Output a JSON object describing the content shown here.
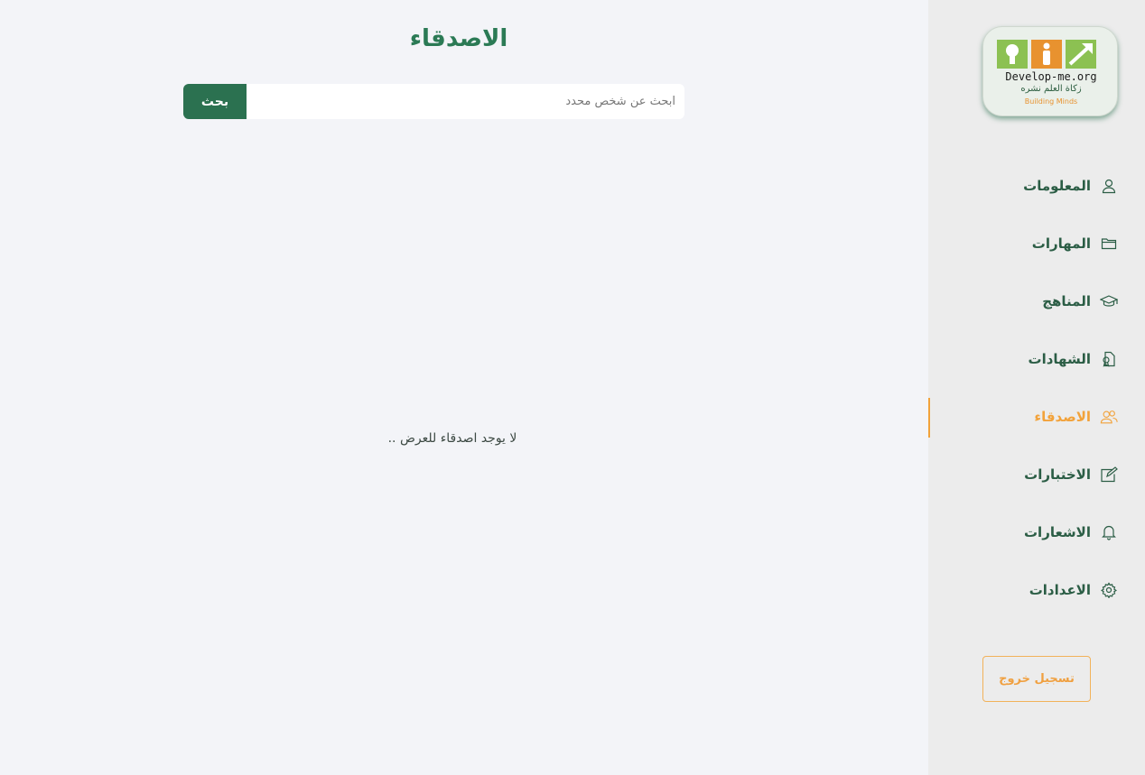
{
  "main": {
    "title": "الاصدقاء",
    "search": {
      "placeholder": "ابحث عن شخص محدد",
      "value": "",
      "button_label": "بحث"
    },
    "empty_message": "لا يوجد اصدقاء للعرض .."
  },
  "sidebar": {
    "logo": {
      "url_text": "Develop-me.org",
      "arabic_text": "زكاة العلم نشره",
      "tagline": "Building Minds"
    },
    "items": [
      {
        "label": "المعلومات",
        "icon": "user-icon"
      },
      {
        "label": "المهارات",
        "icon": "folder-icon"
      },
      {
        "label": "المناهج",
        "icon": "graduation-cap-icon"
      },
      {
        "label": "الشهادات",
        "icon": "certificate-icon"
      },
      {
        "label": "الاصدقاء",
        "icon": "users-icon",
        "active": true
      },
      {
        "label": "الاختبارات",
        "icon": "edit-icon"
      },
      {
        "label": "الاشعارات",
        "icon": "bell-icon"
      },
      {
        "label": "الاعدادات",
        "icon": "gear-icon"
      }
    ],
    "logout_label": "تسجيل خروج"
  },
  "colors": {
    "primary_green": "#2b7150",
    "accent_orange": "#f2a23a",
    "background": "#f3f4f8",
    "sidebar_bg": "#ececec"
  }
}
